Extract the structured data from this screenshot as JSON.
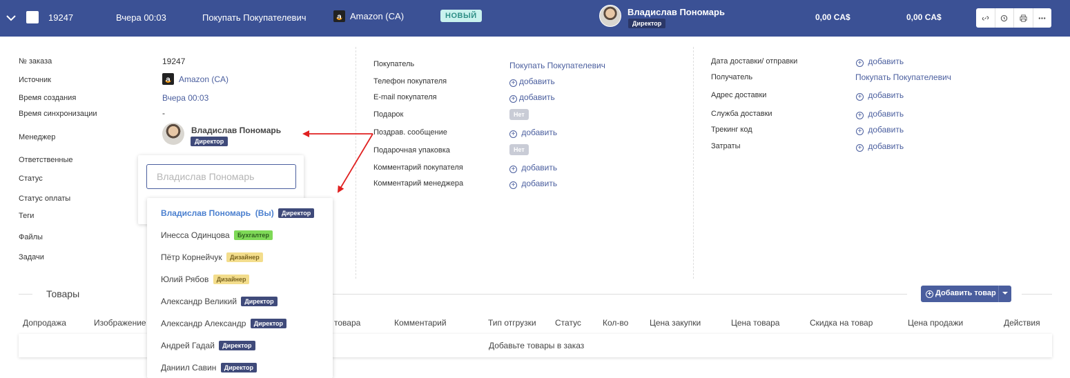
{
  "topbar": {
    "order_id": "19247",
    "created": "Вчера 00:03",
    "buyer": "Покупать Покупателевич",
    "source": "Amazon (CA)",
    "status_badge": "НОВЫЙ",
    "manager_name": "Владислав Пономарь",
    "manager_role": "Директор",
    "amount1": "0,00 CA$",
    "amount2": "0,00 CA$",
    "actions": [
      "link-icon",
      "history-icon",
      "print-icon",
      "more-icon"
    ]
  },
  "order": {
    "labels": {
      "order_no": "№ заказа",
      "source": "Источник",
      "created": "Время создания",
      "sync": "Время синхронизации",
      "manager": "Менеджер",
      "responsible": "Ответственные",
      "status": "Статус",
      "payment_status": "Статус оплаты",
      "tags": "Теги",
      "files": "Файлы",
      "tasks": "Задачи"
    },
    "order_no": "19247",
    "source": "Amazon (CA)",
    "created": "Вчера 00:03",
    "sync": "-",
    "manager_name": "Владислав Пономарь",
    "manager_role": "Директор"
  },
  "buyer_section": {
    "labels": {
      "buyer": "Покупатель",
      "phone": "Телефон покупателя",
      "email": "E-mail покупателя",
      "gift": "Подарок",
      "greeting": "Поздрав. сообщение",
      "gift_wrap": "Подарочная упаковка",
      "buyer_comment": "Комментарий покупателя",
      "manager_comment": "Комментарий менеджера"
    },
    "buyer": "Покупать Покупателевич",
    "no": "Нет",
    "add": "добавить"
  },
  "delivery": {
    "labels": {
      "date": "Дата доставки/ отправки",
      "recipient": "Получатель",
      "address": "Адрес доставки",
      "service": "Служба доставки",
      "tracking": "Трекинг код",
      "costs": "Затраты"
    },
    "recipient": "Покупать Покупателевич",
    "add": "добавить"
  },
  "manager_picker": {
    "placeholder": "Владислав Пономарь",
    "options": [
      {
        "name": "Владислав Пономарь",
        "suffix": "(Вы)",
        "role": "Директор"
      },
      {
        "name": "Инесса Одинцова",
        "role": "Бухгалтер"
      },
      {
        "name": "Пётр Корнейчук",
        "role": "Дизайнер"
      },
      {
        "name": "Юлий Рябов",
        "role": "Дизайнер"
      },
      {
        "name": "Александр Великий",
        "role": "Директор"
      },
      {
        "name": "Александр Александр",
        "role": "Директор"
      },
      {
        "name": "Андрей Гадай",
        "role": "Директор"
      },
      {
        "name": "Даниил Савин",
        "role": "Директор"
      }
    ]
  },
  "goods": {
    "title": "Товары",
    "add_button": "Добавить товар",
    "columns": [
      "Допродажа",
      "Изображение",
      "товара",
      "Комментарий",
      "Тип отгрузки",
      "Статус",
      "Кол-во",
      "Цена закупки",
      "Цена товара",
      "Скидка на товар",
      "Цена продажи",
      "Действия"
    ],
    "empty": "Добавьте товары в заказ"
  },
  "colors": {
    "header_bg": "#3b5195",
    "link": "#4a5e9e",
    "arrow": "#e02020"
  }
}
